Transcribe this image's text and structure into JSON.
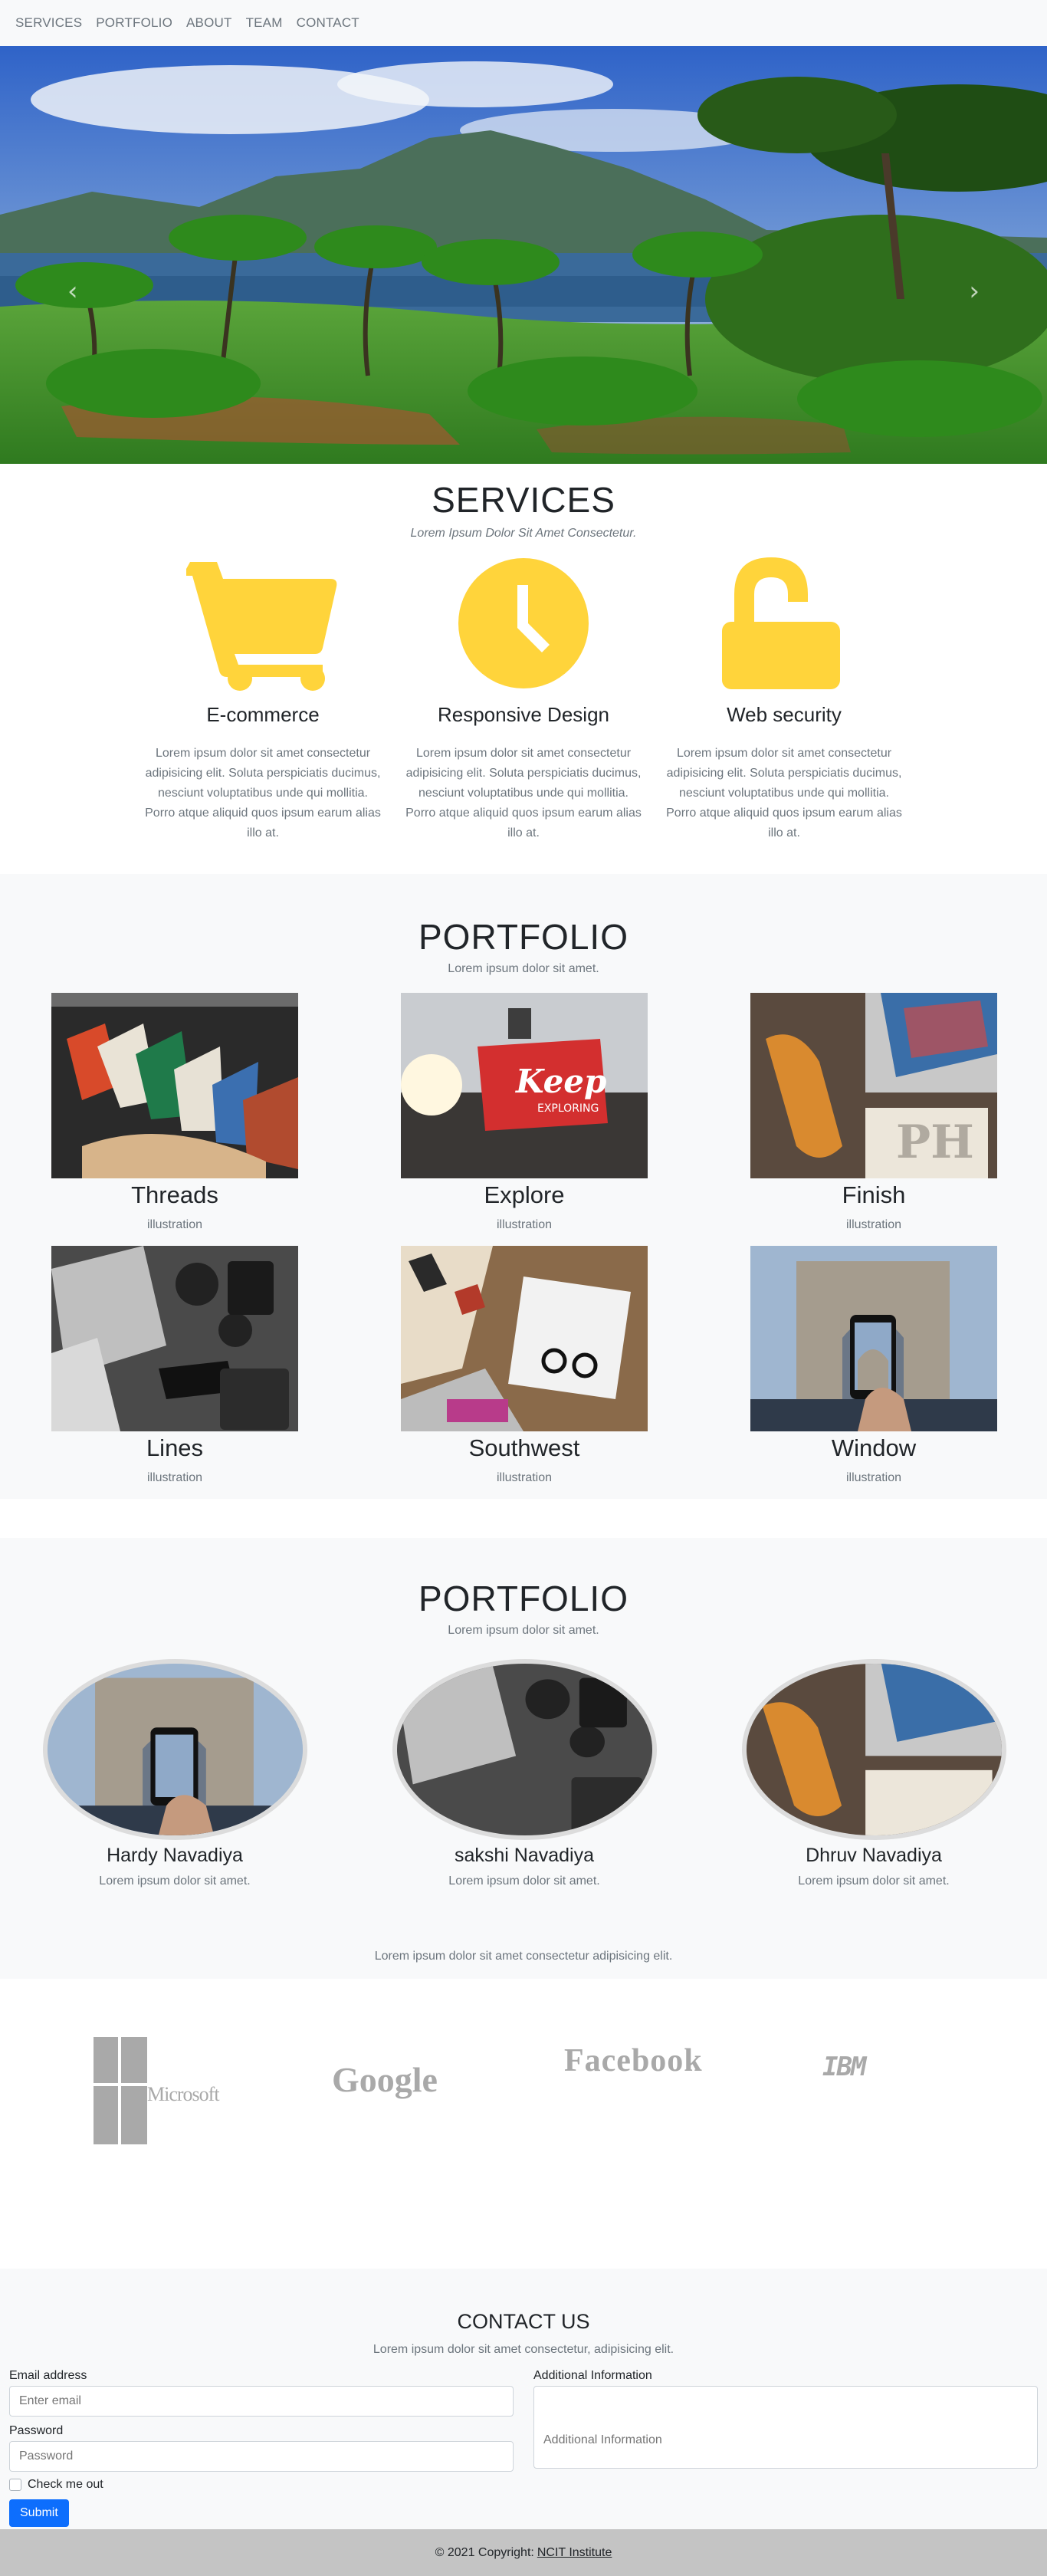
{
  "nav": {
    "items": [
      "SERVICES",
      "PORTFOLIO",
      "ABOUT",
      "TEAM",
      "CONTACT"
    ]
  },
  "hero": {
    "prev_icon": "chevron-left-icon",
    "next_icon": "chevron-right-icon",
    "slides": 3,
    "active_slide": 2
  },
  "services": {
    "title": "SERVICES",
    "subtitle": "Lorem Ipsum Dolor Sit Amet Consectetur.",
    "accent_color": "#ffd43b",
    "items": [
      {
        "icon": "shopping-cart-icon",
        "title": "E-commerce",
        "text": "Lorem ipsum dolor sit amet consectetur adipisicing elit. Soluta perspiciatis ducimus, nesciunt voluptatibus unde qui mollitia. Porro atque aliquid quos ipsum earum alias illo at."
      },
      {
        "icon": "clock-icon",
        "title": "Responsive Design",
        "text": "Lorem ipsum dolor sit amet consectetur adipisicing elit. Soluta perspiciatis ducimus, nesciunt voluptatibus unde qui mollitia. Porro atque aliquid quos ipsum earum alias illo at."
      },
      {
        "icon": "unlock-icon",
        "title": "Web security",
        "text": "Lorem ipsum dolor sit amet consectetur adipisicing elit. Soluta perspiciatis ducimus, nesciunt voluptatibus unde qui mollitia. Porro atque aliquid quos ipsum earum alias illo at."
      }
    ]
  },
  "portfolio": {
    "title": "PORTFOLIO",
    "subtitle": "Lorem ipsum dolor sit amet.",
    "items": [
      {
        "title": "Threads",
        "caption": "illustration"
      },
      {
        "title": "Explore",
        "caption": "illustration"
      },
      {
        "title": "Finish",
        "caption": "illustration"
      },
      {
        "title": "Lines",
        "caption": "illustration"
      },
      {
        "title": "Southwest",
        "caption": "illustration"
      },
      {
        "title": "Window",
        "caption": "illustration"
      }
    ],
    "explore_sign": "Keep",
    "explore_sign_sub": "EXPLORING"
  },
  "team": {
    "title": "PORTFOLIO",
    "subtitle": "Lorem ipsum dolor sit amet.",
    "members": [
      {
        "name": "Hardy Navadiya",
        "text": "Lorem ipsum dolor sit amet."
      },
      {
        "name": "sakshi Navadiya",
        "text": "Lorem ipsum dolor sit amet."
      },
      {
        "name": "Dhruv Navadiya",
        "text": "Lorem ipsum dolor sit amet."
      }
    ],
    "blurb": "Lorem ipsum dolor sit amet consectetur adipisicing elit."
  },
  "clients": {
    "logos": [
      "Microsoft",
      "Google",
      "Facebook",
      "IBM"
    ]
  },
  "contact": {
    "title": "CONTACT US",
    "subtitle": "Lorem ipsum dolor sit amet consectetur, adipisicing elit.",
    "email_label": "Email address",
    "email_placeholder": "Enter email",
    "password_label": "Password",
    "password_placeholder": "Password",
    "info_label": "Additional Information",
    "info_placeholder": "Additional Information",
    "check_label": "Check me out",
    "submit_label": "Submit"
  },
  "footer": {
    "copyright": "© 2021 Copyright:",
    "link": "NCIT Institute"
  }
}
